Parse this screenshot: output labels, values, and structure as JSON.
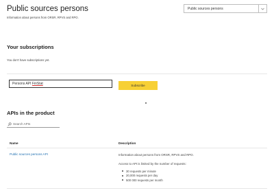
{
  "header": {
    "title": "Public sources persons",
    "subtitle": "Information about persons from ORSR, RPVS and RPO."
  },
  "product_select": {
    "selected": "Public sources persons"
  },
  "subscriptions": {
    "heading": "Your subscriptions",
    "empty_text": "You don't have subscriptions yet."
  },
  "subscribe_form": {
    "name_value_prefix": "Persons API ",
    "name_value_underlined": "FinStat",
    "button_label": "Subscribe"
  },
  "apis": {
    "heading": "APIs in the product",
    "search_placeholder": "Search APIs",
    "columns": [
      "Name",
      "Description"
    ],
    "rows": [
      {
        "name": "Public sources persons API",
        "description": "Information about persons from ORSR, RPVS and RPO.",
        "limit_intro": "Access to API is limited by the number of requests:",
        "limits": [
          "30 requests per minute",
          "20,000 requests per day",
          "500 000 requests per month"
        ]
      }
    ]
  },
  "icons": {
    "search": "search-icon",
    "dropdown": "chevron-down-icon"
  }
}
